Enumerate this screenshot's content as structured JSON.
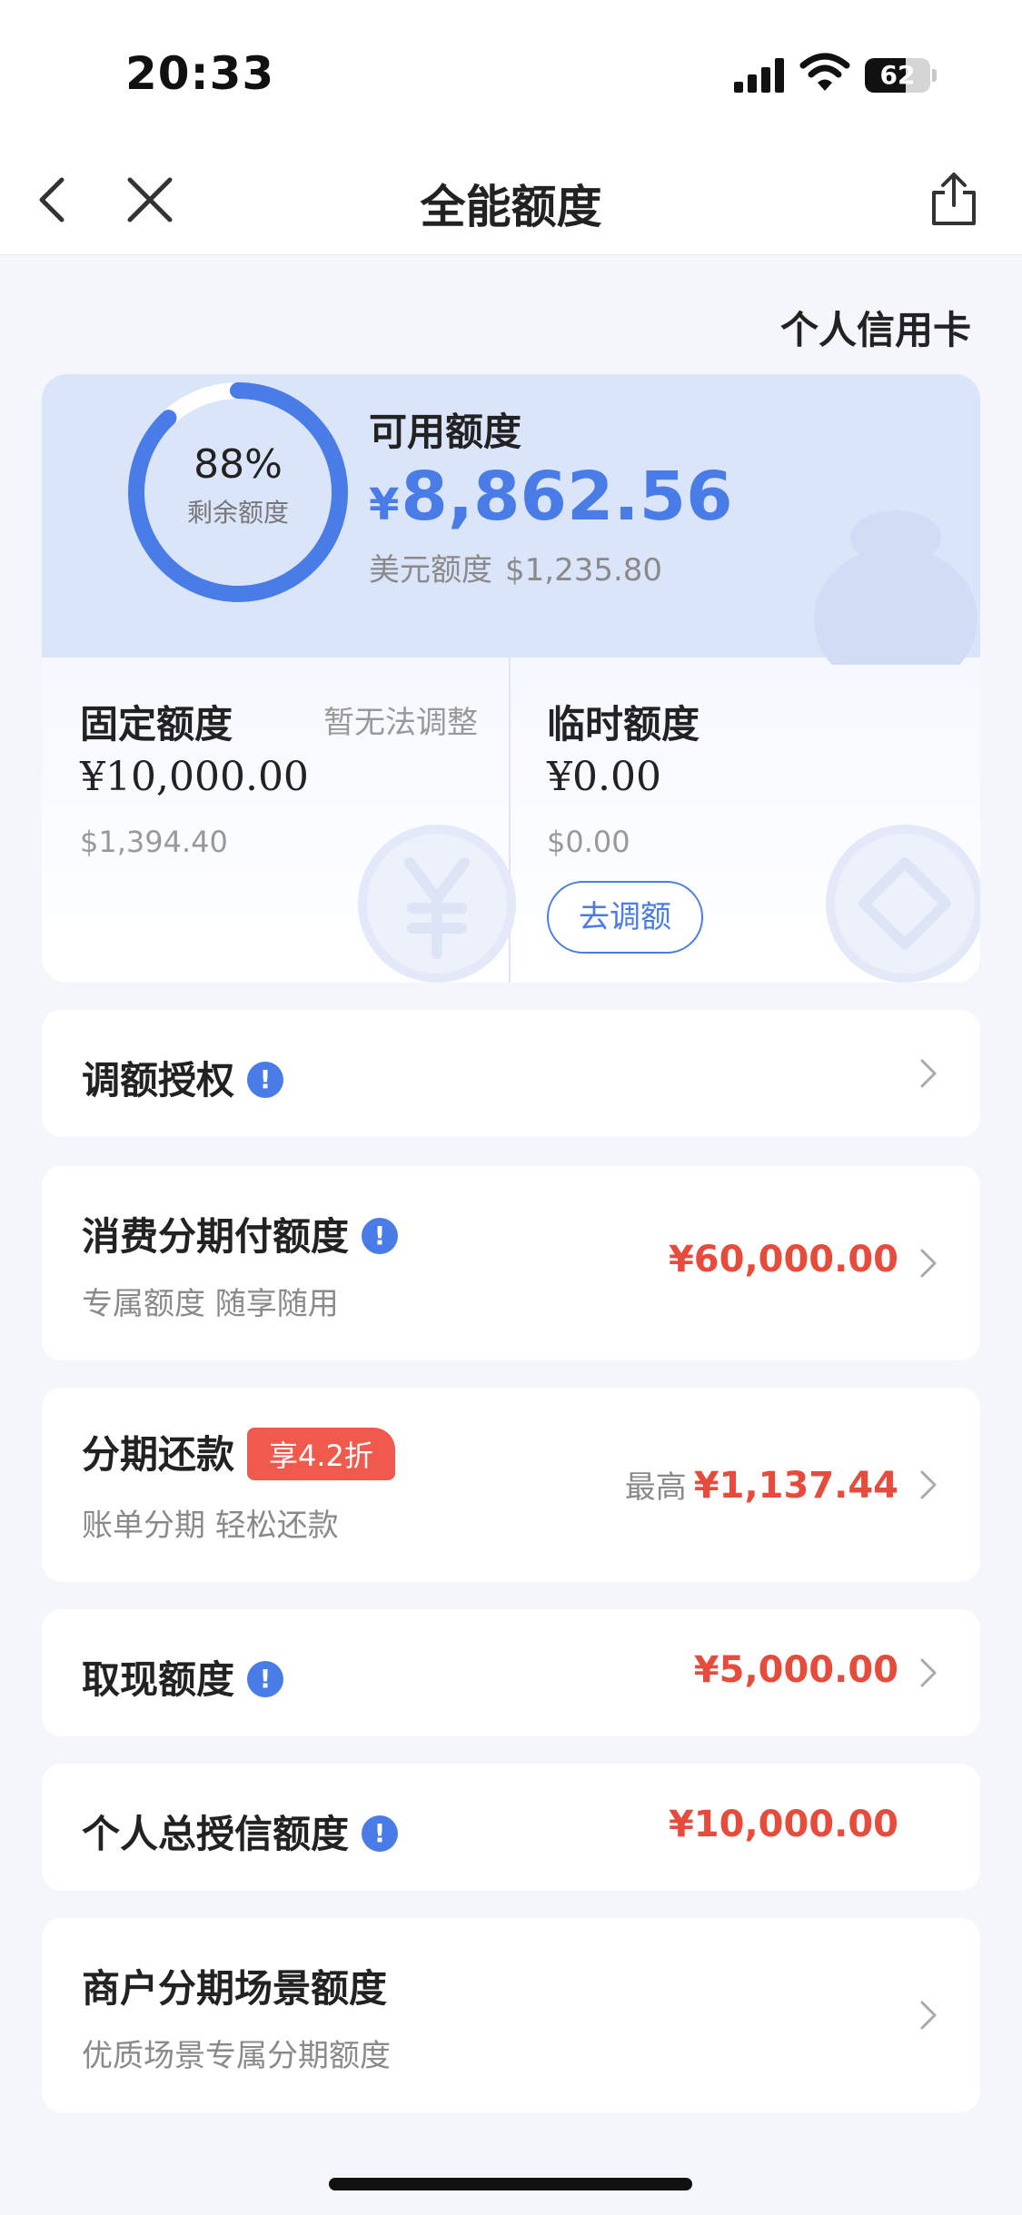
{
  "status_bar": {
    "time": "20:33",
    "battery": "62",
    "battery_level": 0.62
  },
  "nav": {
    "title": "全能额度"
  },
  "card_tab": "个人信用卡",
  "summary": {
    "ring_percent": "88%",
    "ring_percent_value": 0.88,
    "ring_sub": "剩余额度",
    "available_label": "可用额度",
    "available_currency": "¥",
    "available_amount": "8,862.56",
    "usd_label": "美元额度",
    "usd_amount": "$1,235.80",
    "fixed": {
      "label": "固定额度",
      "note": "暂无法调整",
      "amount": "¥10,000.00",
      "usd": "$1,394.40"
    },
    "temporary": {
      "label": "临时额度",
      "amount": "¥0.00",
      "usd": "$0.00",
      "button": "去调额"
    }
  },
  "rows": {
    "auth": {
      "title": "调额授权"
    },
    "installment_pay": {
      "title": "消费分期付额度",
      "sub": "专属额度 随享随用",
      "amount": "¥60,000.00"
    },
    "installment_repay": {
      "title": "分期还款",
      "promo": "享4.2折",
      "sub": "账单分期 轻松还款",
      "prefix": "最高",
      "amount": "¥1,137.44"
    },
    "cash": {
      "title": "取现额度",
      "amount": "¥5,000.00"
    },
    "total_credit": {
      "title": "个人总授信额度",
      "amount": "¥10,000.00"
    },
    "merchant": {
      "title": "商户分期场景额度",
      "sub": "优质场景专属分期额度"
    }
  },
  "icons": {
    "info": "!",
    "chevron": "chevron-right-icon",
    "back": "chevron-left-icon",
    "close": "close-icon",
    "share": "share-icon"
  },
  "colors": {
    "accent": "#4a7ce8",
    "amount_red": "#e74b3c",
    "promo_bg": "#ef5a4d",
    "background": "#f4f6fb"
  }
}
